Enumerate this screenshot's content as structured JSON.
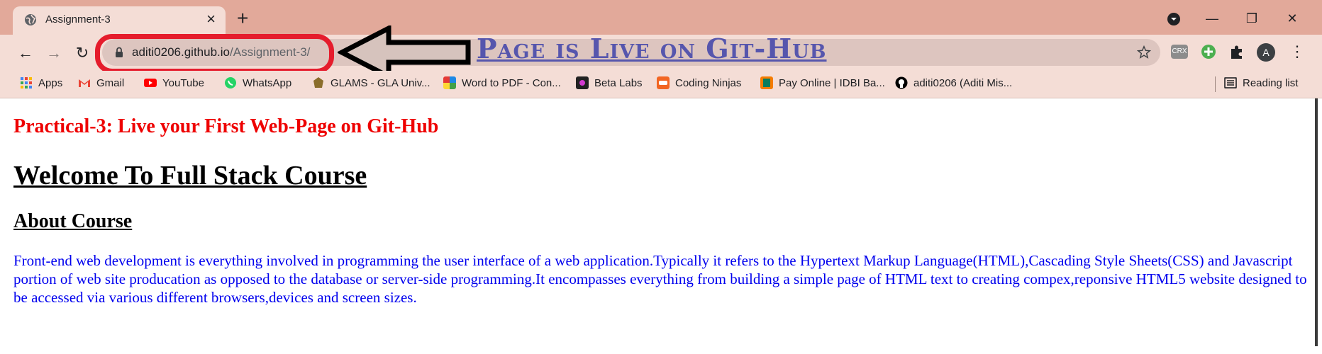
{
  "browser": {
    "tab": {
      "title": "Assignment-3",
      "favicon": "globe-icon"
    },
    "new_tab_symbol": "+",
    "window_controls": {
      "profile_dropdown": "chevron-down-icon",
      "minimize": "—",
      "maximize": "❐",
      "close": "✕"
    },
    "nav": {
      "back": "←",
      "forward": "→",
      "reload": "↻"
    },
    "omnibox": {
      "host": "aditi0206.github.io",
      "path": "/Assignment-3/"
    },
    "extensions": [
      "CRX",
      "plus-extension-icon",
      "puzzle-icon"
    ],
    "avatar_letter": "A",
    "menu": "⋮"
  },
  "annotation": {
    "caption": "Page is Live on Git-Hub",
    "highlight_color": "#e51c2c",
    "arrow_color": "#000000"
  },
  "bookmarks": {
    "items": [
      {
        "label": "Apps",
        "icon": "apps-grid-icon",
        "color": "#4285f4"
      },
      {
        "label": "Gmail",
        "icon": "gmail-icon",
        "color": "#ea4335"
      },
      {
        "label": "YouTube",
        "icon": "youtube-icon",
        "color": "#ff0000"
      },
      {
        "label": "WhatsApp",
        "icon": "whatsapp-icon",
        "color": "#25d366"
      },
      {
        "label": "GLAMS - GLA Univ...",
        "icon": "glams-icon",
        "color": "#7a5a20"
      },
      {
        "label": "Word to PDF - Con...",
        "icon": "word-to-pdf-icon",
        "color": "#e53935"
      },
      {
        "label": "Beta Labs",
        "icon": "beta-labs-icon",
        "color": "#222222"
      },
      {
        "label": "Coding Ninjas",
        "icon": "coding-ninjas-icon",
        "color": "#f26522"
      },
      {
        "label": "Pay Online | IDBI Ba...",
        "icon": "idbi-icon",
        "color": "#f57c00"
      },
      {
        "label": "aditi0206 (Aditi Mis...",
        "icon": "github-icon",
        "color": "#000000"
      }
    ],
    "reading_list": "Reading list"
  },
  "page": {
    "practical_heading": "Practical-3: Live your First Web-Page on Git-Hub",
    "title": "Welcome To Full Stack Course",
    "section_heading": "About Course",
    "paragraph": "Front-end web development is everything involved in programming the user interface of a web application.Typically it refers to the Hypertext Markup Language(HTML),Cascading Style Sheets(CSS) and Javascript portion of web site producation as opposed to the database or server-side programming.It encompasses everything from building a simple page of HTML text to creating compex,reponsive HTML5 website designed to be accessed via various different browsers,devices and screen sizes.",
    "colors": {
      "practical": "#ee0000",
      "paragraph": "#0000ee"
    }
  }
}
